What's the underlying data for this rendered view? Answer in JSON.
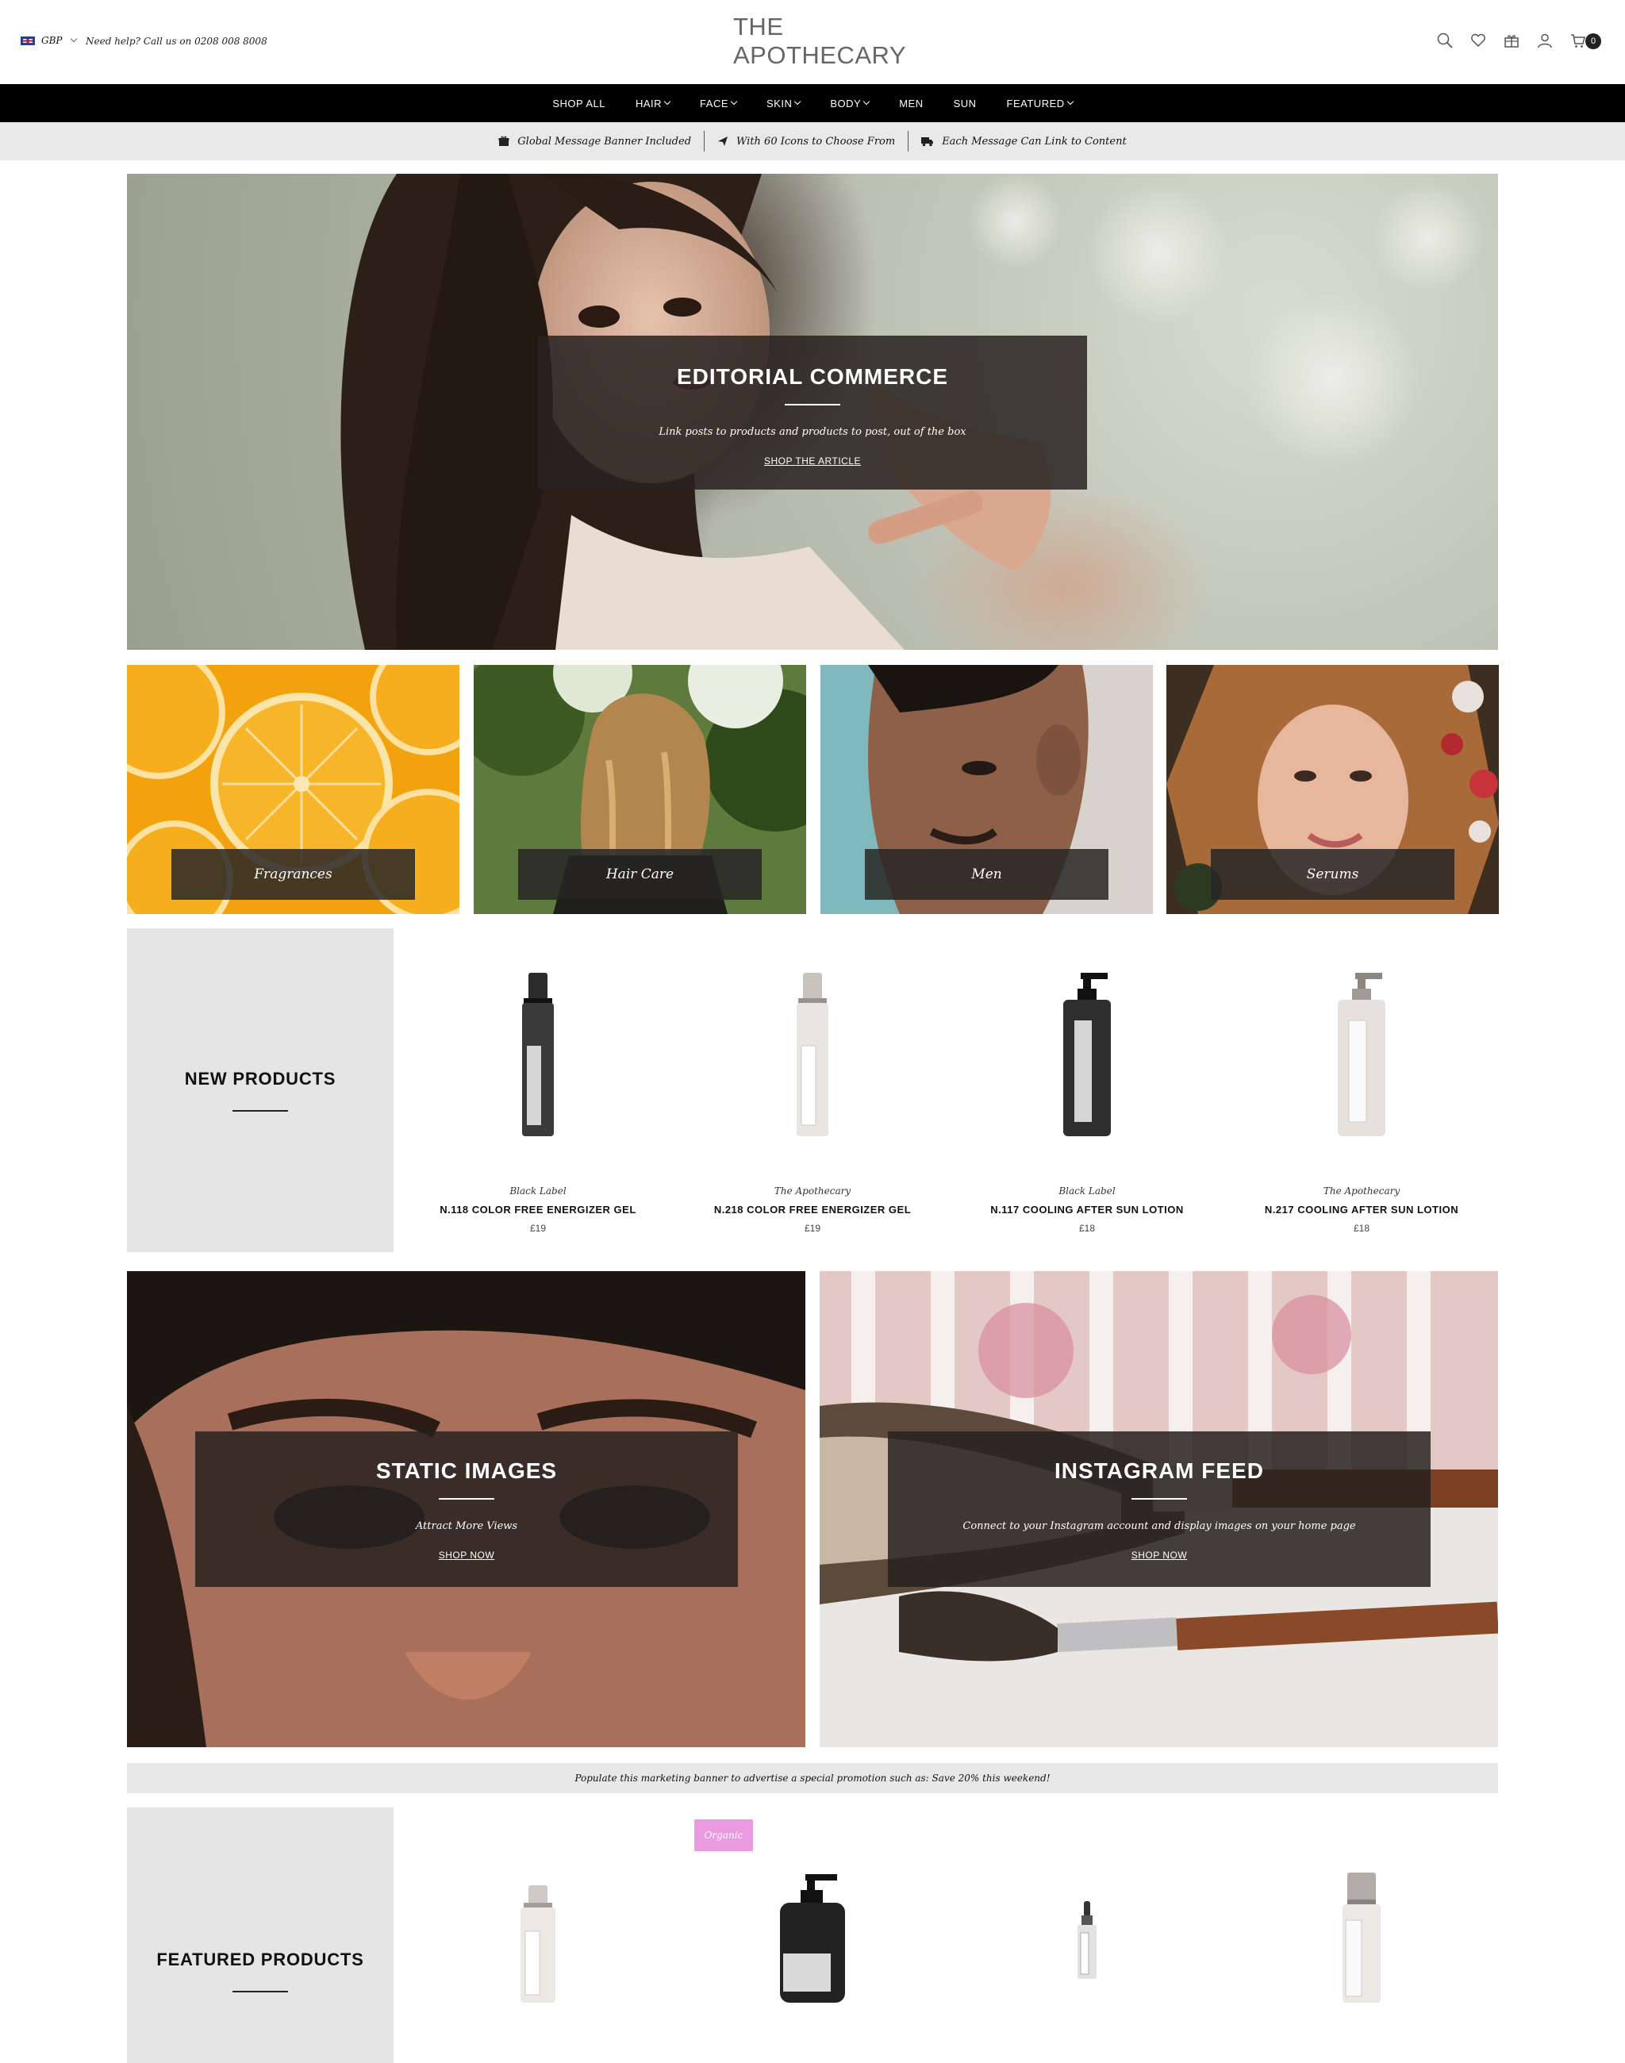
{
  "header": {
    "currency": "GBP",
    "help_text": "Need help? Call us on 0208 008 8008",
    "logo_line1": "THE",
    "logo_line2": "APOTHECARY",
    "cart_count": "0",
    "icons": [
      "search-icon",
      "heart-icon",
      "gift-icon",
      "account-icon",
      "cart-icon"
    ]
  },
  "nav": {
    "items": [
      {
        "label": "SHOP ALL",
        "dropdown": false
      },
      {
        "label": "HAIR",
        "dropdown": true
      },
      {
        "label": "FACE",
        "dropdown": true
      },
      {
        "label": "SKIN",
        "dropdown": true
      },
      {
        "label": "BODY",
        "dropdown": true
      },
      {
        "label": "MEN",
        "dropdown": false
      },
      {
        "label": "SUN",
        "dropdown": false
      },
      {
        "label": "FEATURED",
        "dropdown": true
      }
    ]
  },
  "messages": [
    {
      "icon": "gift-icon",
      "text": "Global Message Banner Included"
    },
    {
      "icon": "paper-plane-icon",
      "text": "With 60 Icons to Choose From"
    },
    {
      "icon": "truck-icon",
      "text": "Each Message Can Link to Content"
    }
  ],
  "hero": {
    "title": "EDITORIAL COMMERCE",
    "subtitle": "Link posts to products and products to post, out of the box",
    "link": "SHOP THE ARTICLE"
  },
  "categories": [
    {
      "label": "Fragrances"
    },
    {
      "label": "Hair Care"
    },
    {
      "label": "Men"
    },
    {
      "label": "Serums"
    }
  ],
  "new_products": {
    "title": "NEW PRODUCTS",
    "items": [
      {
        "brand": "Black Label",
        "name": "N.118 COLOR FREE ENERGIZER GEL",
        "price": "£19",
        "bottle": "dark-airless"
      },
      {
        "brand": "The Apothecary",
        "name": "N.218 COLOR FREE ENERGIZER GEL",
        "price": "£19",
        "bottle": "light-airless"
      },
      {
        "brand": "Black Label",
        "name": "N.117 COOLING AFTER SUN LOTION",
        "price": "£18",
        "bottle": "dark-pump"
      },
      {
        "brand": "The Apothecary",
        "name": "N.217 COOLING AFTER SUN LOTION",
        "price": "£18",
        "bottle": "light-pump"
      }
    ]
  },
  "promos": [
    {
      "title": "STATIC IMAGES",
      "subtitle": "Attract More Views",
      "link": "SHOP NOW"
    },
    {
      "title": "INSTAGRAM FEED",
      "subtitle": "Connect to your Instagram account and display images on your home page",
      "link": "SHOP NOW"
    }
  ],
  "marketing_banner": "Populate this marketing banner to advertise a special promotion such as: Save 20% this weekend!",
  "featured_products": {
    "title": "FEATURED PRODUCTS",
    "badge": "Organic"
  },
  "colors": {
    "nav_bg": "#000000",
    "banner_bg": "#e9e9e9",
    "card_bg": "#e5e5e5",
    "badge": "#ea9be0",
    "overlay": "#282220"
  }
}
